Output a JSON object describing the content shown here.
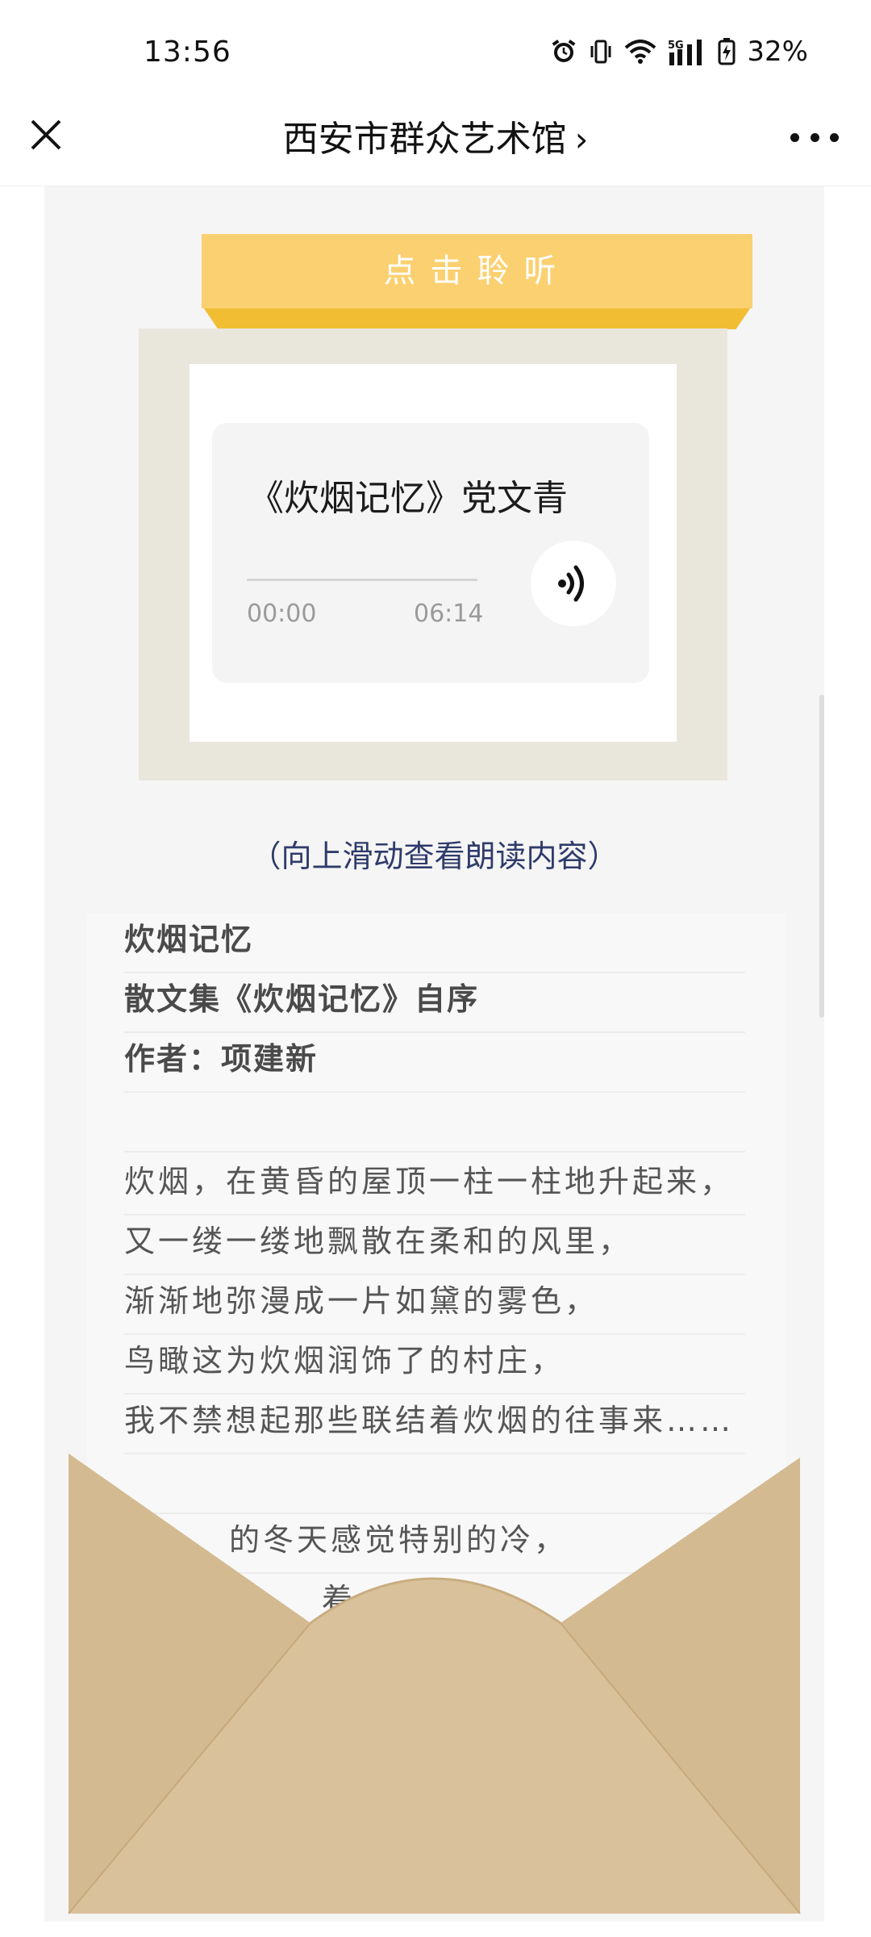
{
  "status": {
    "time": "13:56",
    "network": "5G",
    "battery": "32%",
    "icons": [
      "alarm-icon",
      "vibrate-icon",
      "wifi-icon",
      "signal-icon",
      "battery-charging-icon"
    ]
  },
  "nav": {
    "title": "西安市群众艺术馆",
    "title_chevron": "›",
    "close_icon": "close-icon",
    "more_icon": "more-dots-icon"
  },
  "banner": {
    "label": "点击聆听"
  },
  "player": {
    "title": "《炊烟记忆》党文青",
    "current_time": "00:00",
    "duration": "06:14",
    "progress": 0,
    "icon": "audio-wave-icon"
  },
  "hint": "（向上滑动查看朗读内容）",
  "reading": {
    "lines": [
      "炊烟记忆",
      "散文集《炊烟记忆》自序",
      "作者：项建新",
      "",
      "炊烟，在黄昏的屋顶一柱一柱地升起来，",
      "又一缕一缕地飘散在柔和的风里，",
      "渐渐地弥漫成一片如黛的雾色，",
      "鸟瞰这为炊烟润饰了的村庄，",
      "我不禁想起那些联结着炊烟的往事来……",
      "",
      "的冬天感觉特别的冷，",
      "着，"
    ]
  },
  "colors": {
    "banner": "#fbd070",
    "banner_shadow": "#f1be33",
    "frame": "#e9e6dc",
    "envelope": "#d6be96",
    "hint_text": "#2f3b6b"
  }
}
